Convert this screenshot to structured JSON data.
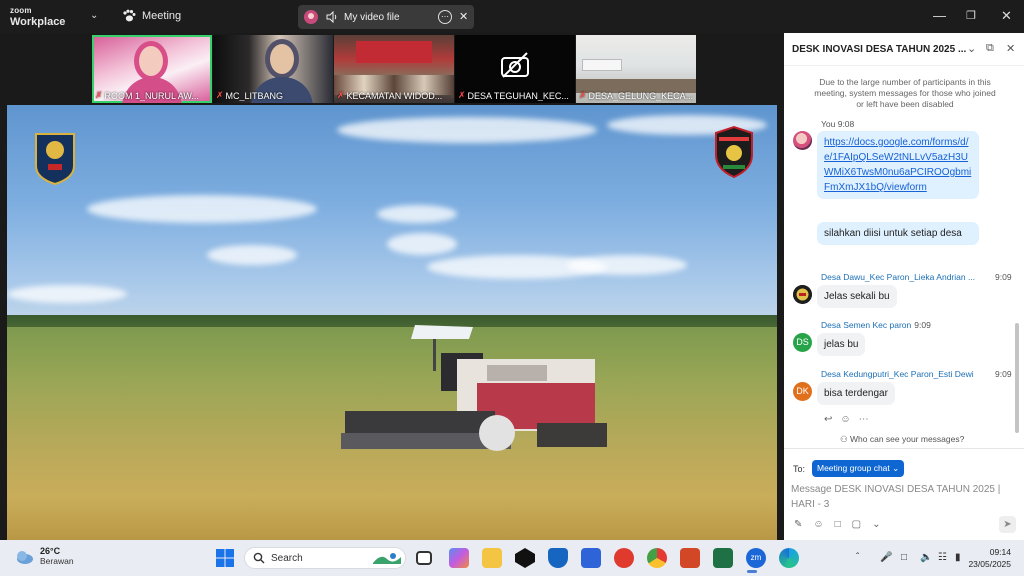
{
  "titlebar": {
    "brand": "zoom",
    "product": "Workplace",
    "meeting_label": "Meeting",
    "share_label": "My video file"
  },
  "participants": [
    {
      "name": "ROOM 1_NURUL AW...",
      "muted": true,
      "active": true
    },
    {
      "name": "MC_LITBANG",
      "muted": true,
      "active": false
    },
    {
      "name": "KECAMATAN WIDOD...",
      "muted": true,
      "active": false
    },
    {
      "name": "DESA TEGUHAN_KEC...",
      "muted": true,
      "active": false,
      "video_off": true
    },
    {
      "name": "DESA_GELUNG_KECA...",
      "muted": true,
      "active": false
    }
  ],
  "chat": {
    "title": "DESK INOVASI DESA TAHUN 2025 ...",
    "system_message": "Due to the large number of participants in this meeting, system messages for those who joined or left have been disabled",
    "messages": [
      {
        "sender": "You",
        "time": "9:08",
        "link": "https://docs.google.com/forms/d/e/1FAIpQLSeW2tNLLvV5azH3UWMiX6TwsM0nu6aPCIROOgbmiFmXmJX1bQ/viewform",
        "text": "silahkan diisi untuk setiap desa"
      },
      {
        "sender": "Desa Dawu_Kec Paron_Lieka Andrian ...",
        "time": "9:09",
        "text": "Jelas sekali bu"
      },
      {
        "sender": "Desa Semen Kec paron",
        "time": "9:09",
        "initials": "DS",
        "text": "jelas bu"
      },
      {
        "sender": "Desa Kedungputri_Kec Paron_Esti Dewi",
        "time": "9:09",
        "initials": "DK",
        "text": "bisa terdengar"
      }
    ],
    "who_can_see": "Who can see your messages?",
    "to_label": "To:",
    "to_target": "Meeting group chat",
    "input_placeholder": "Message DESK INOVASI DESA TAHUN 2025 | HARI - 3"
  },
  "taskbar": {
    "weather_temp": "26°C",
    "weather_cond": "Berawan",
    "search_label": "Search",
    "time": "09:14",
    "date": "23/05/2025"
  },
  "colors": {
    "zoom_blue": "#0e66d2",
    "active_speaker": "#37d16b",
    "muted_red": "#ff4d4d",
    "avatar_ds": "#27a44a",
    "avatar_dk": "#e0701c"
  }
}
